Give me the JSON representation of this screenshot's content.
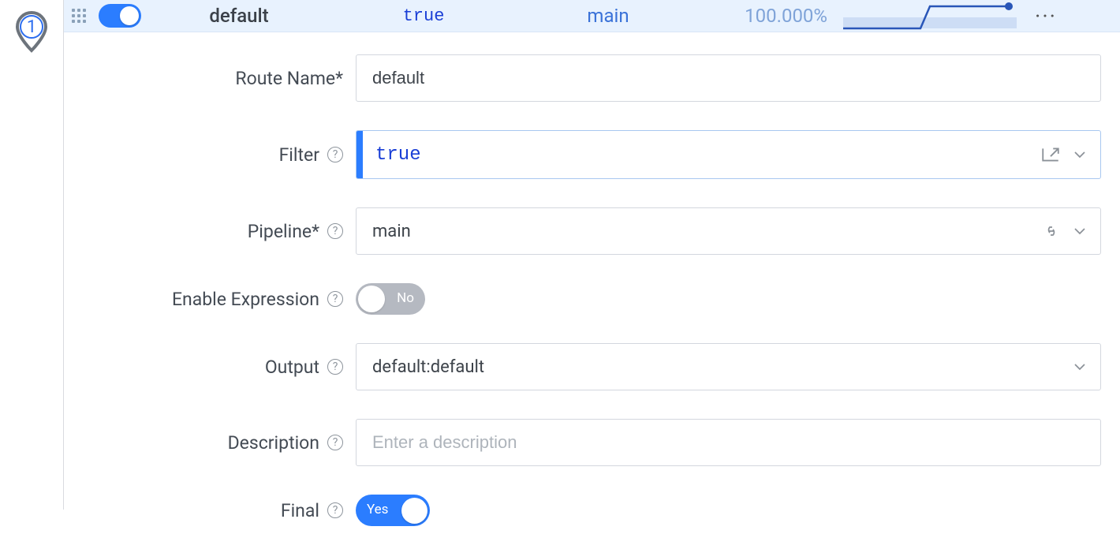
{
  "badge": {
    "number": "1"
  },
  "header": {
    "name": "default",
    "filter": "true",
    "pipeline": "main",
    "percent": "100.000%"
  },
  "labels": {
    "routeName": "Route Name*",
    "filter": "Filter",
    "pipeline": "Pipeline*",
    "enableExpression": "Enable Expression",
    "output": "Output",
    "description": "Description",
    "final": "Final"
  },
  "fields": {
    "routeName": "default",
    "filter": "true",
    "pipeline": "main",
    "enableExpression": "No",
    "output": "default:default",
    "descriptionPlaceholder": "Enter a description",
    "final": "Yes"
  }
}
